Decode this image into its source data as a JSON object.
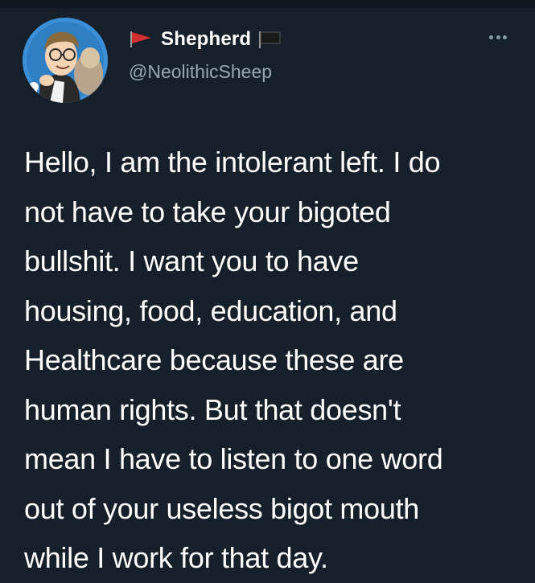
{
  "author": {
    "display_name": "Shepherd",
    "handle": "@NeolithicSheep",
    "avatar_icon": "cartoon-portrait-avatar",
    "name_prefix_icon": "red-flag-icon",
    "name_suffix_icon": "black-flag-icon"
  },
  "tweet": {
    "text": "Hello, I am the intolerant left. I do\nnot have to take your bigoted\nbullshit. I want you to have\nhousing, food, education, and\nHealthcare because these are\nhuman rights. But that doesn't\nmean I have to listen to one word\nout of your useless bigot mouth\nwhile I work for that day."
  },
  "menu": {
    "icon": "more-options-icon"
  },
  "colors": {
    "background": "#15202b",
    "text": "#ffffff",
    "secondary_text": "#9aa7b3",
    "red_flag": "#d32f2f",
    "black_flag": "#1a1a1a"
  }
}
